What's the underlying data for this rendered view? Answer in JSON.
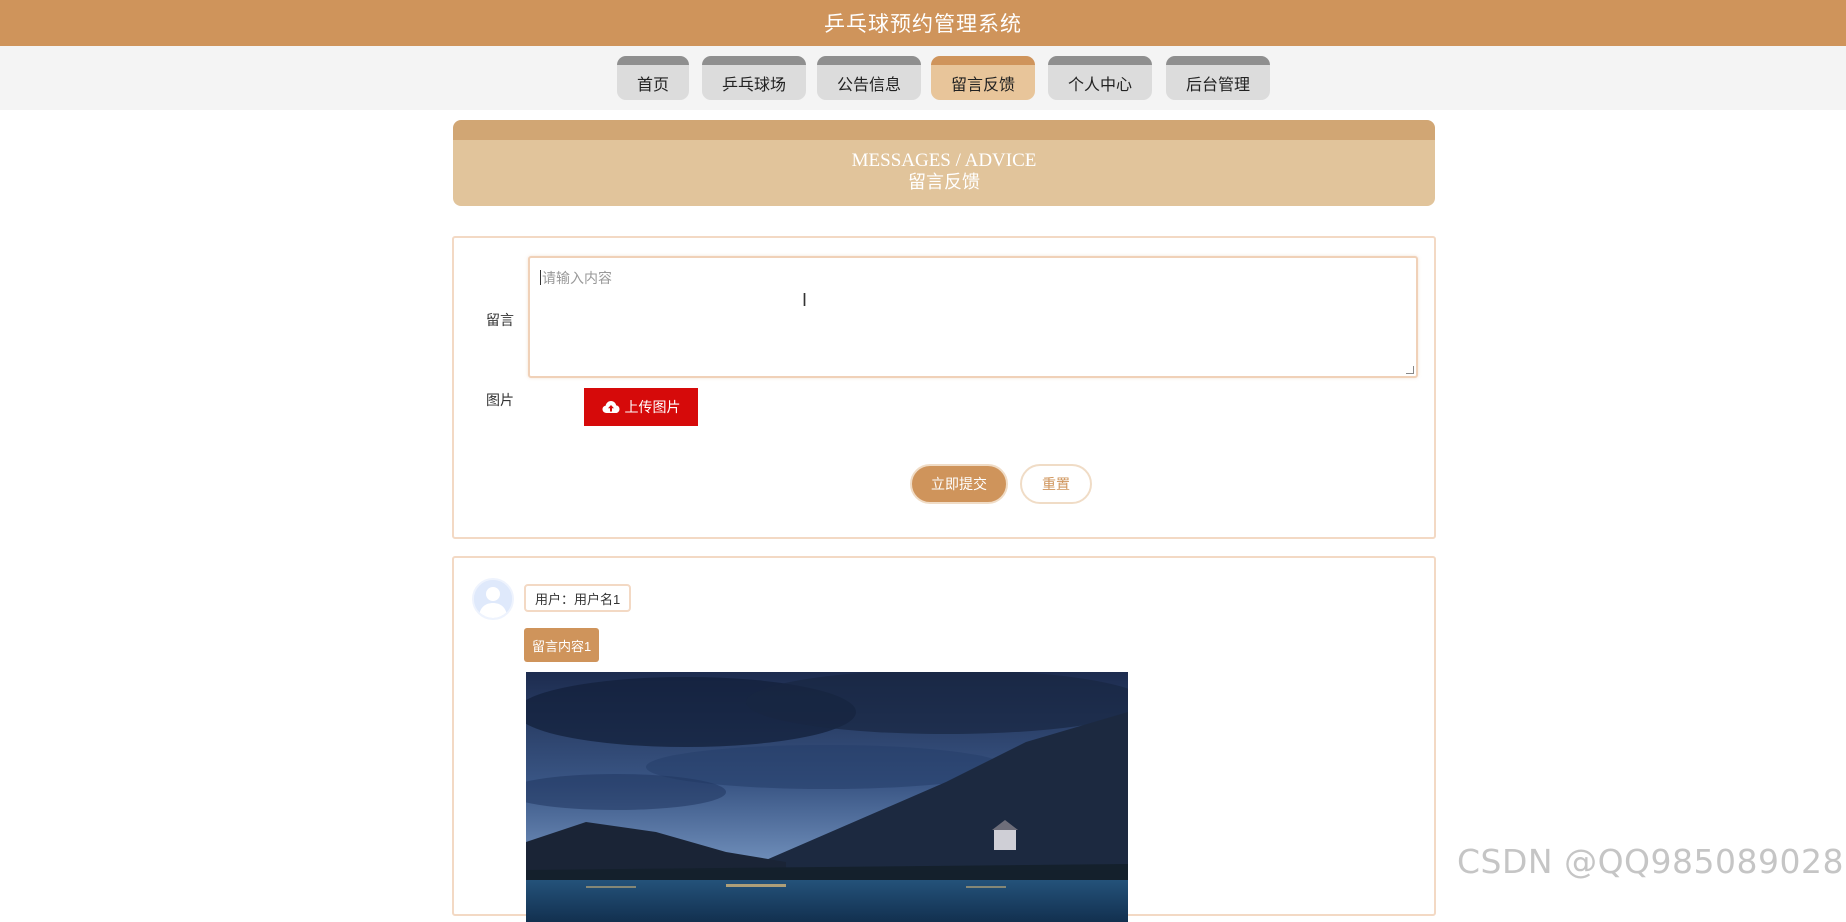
{
  "app": {
    "title": "乒乓球预约管理系统"
  },
  "nav": {
    "items": [
      {
        "label": "首页"
      },
      {
        "label": "乒乓球场"
      },
      {
        "label": "公告信息"
      },
      {
        "label": "留言反馈",
        "active": true
      },
      {
        "label": "个人中心"
      },
      {
        "label": "后台管理"
      }
    ]
  },
  "section": {
    "title_en": "MESSAGES / ADVICE",
    "title_zh": "留言反馈"
  },
  "form": {
    "message_label": "留言",
    "message_placeholder": "请输入内容",
    "image_label": "图片",
    "upload_label": "上传图片",
    "submit_label": "立即提交",
    "reset_label": "重置"
  },
  "messages": [
    {
      "user_text": "用户：用户名1",
      "content": "留言内容1"
    }
  ],
  "watermark": "CSDN @QQ985089028",
  "colors": {
    "brand": "#cf945b",
    "nav_active": "#e8c59a",
    "upload": "#d60a0a"
  }
}
